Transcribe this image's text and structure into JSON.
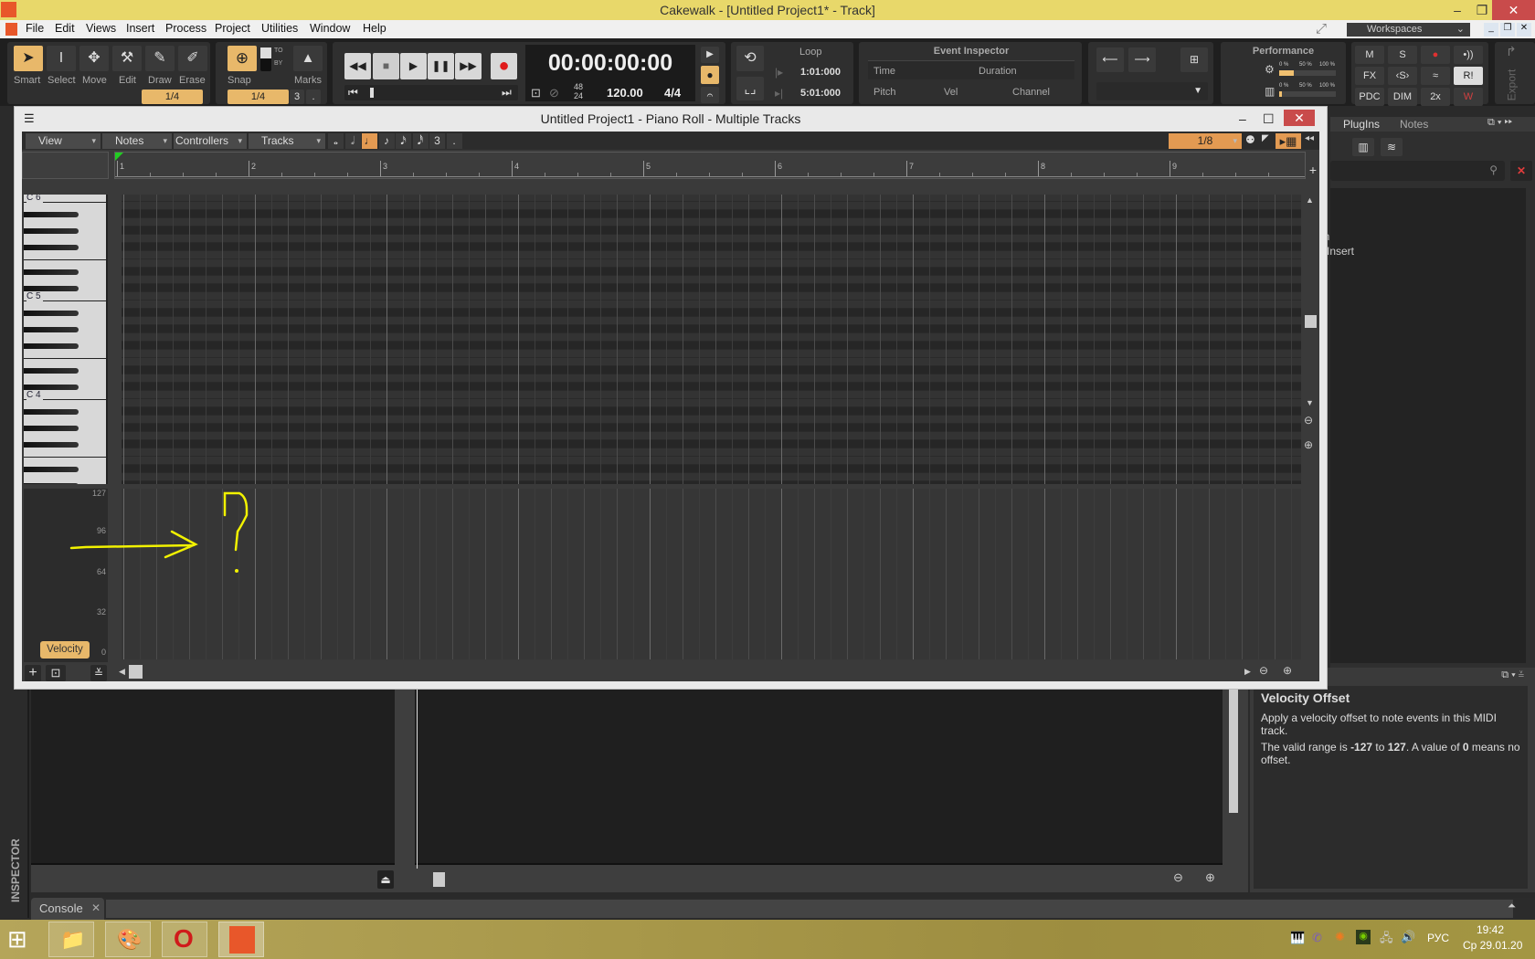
{
  "app": {
    "title": "Cakewalk - [Untitled Project1* - Track]"
  },
  "menu": [
    "File",
    "Edit",
    "Views",
    "Insert",
    "Process",
    "Project",
    "Utilities",
    "Window",
    "Help"
  ],
  "workspaces": "Workspaces",
  "tools": {
    "items": [
      "Smart",
      "Select",
      "Move",
      "Edit",
      "Draw",
      "Erase"
    ],
    "active": "Smart",
    "resolution": "1/4"
  },
  "snap": {
    "label": "Snap",
    "to": "TO",
    "by": "BY",
    "marks": "Marks",
    "value": "1/4",
    "triplet": "3",
    "dot": "."
  },
  "transport": {
    "time": "00:00:00:00",
    "sample_rate_top": "48",
    "sample_rate_bottom": "24",
    "tempo": "120.00",
    "meter": "4/4"
  },
  "loop": {
    "title": "Loop",
    "start": "1:01:000",
    "end": "5:01:000"
  },
  "event_inspector": {
    "title": "Event Inspector",
    "time": "Time",
    "duration": "Duration",
    "pitch": "Pitch",
    "vel": "Vel",
    "channel": "Channel"
  },
  "performance": {
    "title": "Performance",
    "scale": [
      "0 %",
      "50 %",
      "100 %"
    ],
    "audio_load": 0.25,
    "disk_load": 0.05
  },
  "mix_buttons": [
    "M",
    "S",
    "●",
    "•))",
    "FX",
    "‹S›",
    "≈",
    "R!",
    "PDC",
    "DIM",
    "2x",
    "W"
  ],
  "export_label": "Export",
  "piano_roll": {
    "title": "Untitled Project1 - Piano Roll - Multiple Tracks",
    "menus": [
      "View",
      "Notes",
      "Controllers",
      "Tracks"
    ],
    "durations": [
      "𝅝",
      "𝅗𝅥",
      "♩",
      "♪",
      "𝅘𝅥𝅯",
      "𝅘𝅥𝅰",
      "3",
      "."
    ],
    "active_duration": "♩",
    "snap_value": "1/8",
    "measures": [
      "1",
      "2",
      "3",
      "4",
      "5",
      "6",
      "7",
      "8",
      "9"
    ],
    "octave_labels": [
      "C 6",
      "C 5",
      "C 4"
    ],
    "velocity_ticks": [
      "127",
      "96",
      "64",
      "32",
      "0"
    ],
    "controller_label": "Velocity"
  },
  "browser": {
    "tabs": [
      "PlugIns",
      "Notes"
    ],
    "items": [
      "in",
      "l Insert"
    ]
  },
  "help": {
    "title": "Velocity Offset",
    "p1": "Apply a velocity offset to note events in this MIDI track.",
    "p2_a": "The valid range is ",
    "p2_b": "-127",
    "p2_c": " to ",
    "p2_d": "127",
    "p2_e": ". A value of ",
    "p2_f": "0",
    "p2_g": " means no offset."
  },
  "inspector_label": "INSPECTOR",
  "console": {
    "tab": "Console"
  },
  "tray": {
    "lang": "РУС",
    "time": "19:42",
    "date": "Ср 29.01.20"
  },
  "colors": {
    "accent": "#e8b86a",
    "annotation": "#f2f200",
    "title_bar": "#e8d86a",
    "close": "#c94b4b"
  }
}
